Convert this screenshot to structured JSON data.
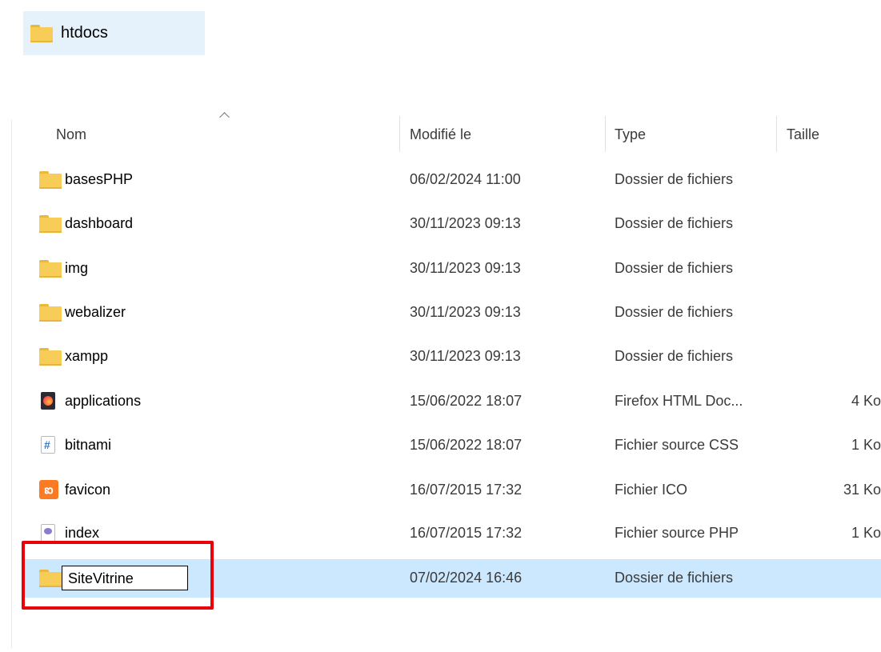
{
  "breadcrumb": {
    "label": "htdocs",
    "icon": "folder-icon"
  },
  "columns": {
    "name": "Nom",
    "modified": "Modifié le",
    "type": "Type",
    "size": "Taille"
  },
  "rows": [
    {
      "name": "basesPHP",
      "modified": "06/02/2024 11:00",
      "type": "Dossier de fichiers",
      "size": "",
      "icon": "folder-icon"
    },
    {
      "name": "dashboard",
      "modified": "30/11/2023 09:13",
      "type": "Dossier de fichiers",
      "size": "",
      "icon": "folder-icon"
    },
    {
      "name": "img",
      "modified": "30/11/2023 09:13",
      "type": "Dossier de fichiers",
      "size": "",
      "icon": "folder-icon"
    },
    {
      "name": "webalizer",
      "modified": "30/11/2023 09:13",
      "type": "Dossier de fichiers",
      "size": "",
      "icon": "folder-icon"
    },
    {
      "name": "xampp",
      "modified": "30/11/2023 09:13",
      "type": "Dossier de fichiers",
      "size": "",
      "icon": "folder-icon"
    },
    {
      "name": "applications",
      "modified": "15/06/2022 18:07",
      "type": "Firefox HTML Doc...",
      "size": "4 Ko",
      "icon": "firefox-html-icon"
    },
    {
      "name": "bitnami",
      "modified": "15/06/2022 18:07",
      "type": "Fichier source CSS",
      "size": "1 Ko",
      "icon": "css-file-icon"
    },
    {
      "name": "favicon",
      "modified": "16/07/2015 17:32",
      "type": "Fichier ICO",
      "size": "31 Ko",
      "icon": "xampp-icon"
    },
    {
      "name": "index",
      "modified": "16/07/2015 17:32",
      "type": "Fichier source PHP",
      "size": "1 Ko",
      "icon": "php-file-icon"
    },
    {
      "name": "SiteVitrine",
      "modified": "07/02/2024 16:46",
      "type": "Dossier de fichiers",
      "size": "",
      "icon": "folder-icon",
      "selected": true,
      "renaming": true
    }
  ],
  "colors": {
    "selection": "#cce8ff",
    "breadcrumb_bg": "#e5f1fb",
    "annotation": "#e8000b",
    "folder": "#f7cd57"
  }
}
